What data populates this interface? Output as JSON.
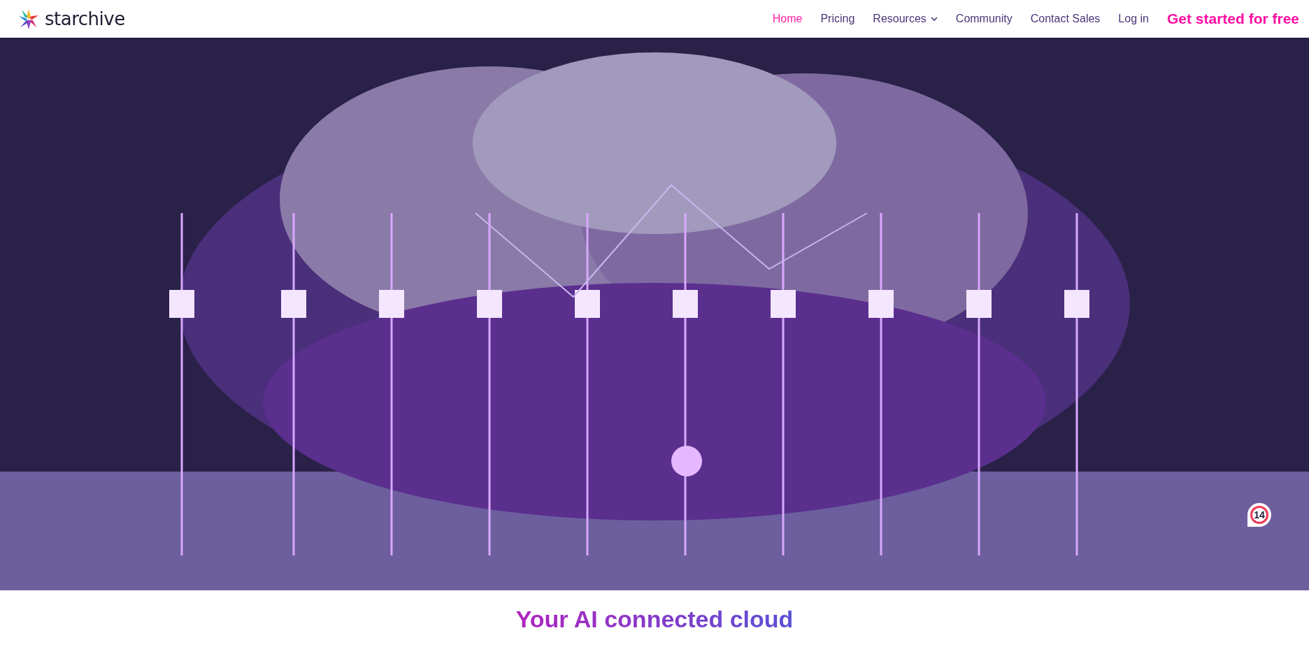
{
  "header": {
    "logo_text": "starchive",
    "nav": [
      {
        "label": "Home",
        "selected": true,
        "kind": "link"
      },
      {
        "label": "Pricing",
        "selected": false,
        "kind": "link"
      },
      {
        "label": "Resources",
        "selected": false,
        "kind": "dropdown"
      },
      {
        "label": "Community",
        "selected": false,
        "kind": "link"
      },
      {
        "label": "Contact Sales",
        "selected": false,
        "kind": "link"
      },
      {
        "label": "Log in",
        "selected": false,
        "kind": "link"
      },
      {
        "label": "Get started for free",
        "kind": "cta"
      }
    ]
  },
  "hero": {
    "kind": "picture",
    "badge": "14"
  },
  "headline": "Your AI connected cloud"
}
